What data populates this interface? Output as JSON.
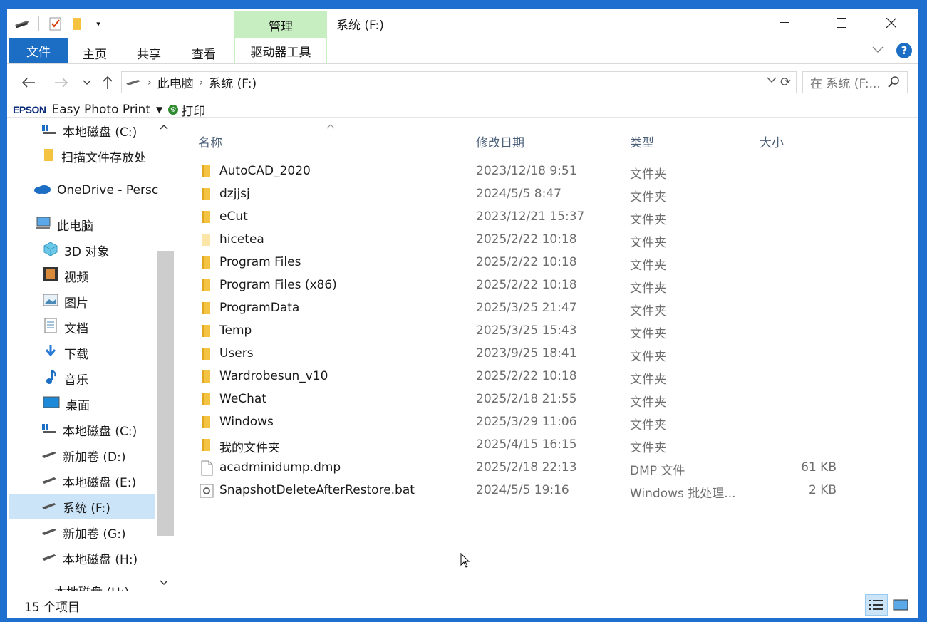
{
  "window": {
    "title": "系统 (F:)",
    "manage_tab": "管理",
    "minimize": "—",
    "maximize": "☐",
    "close": "✕"
  },
  "ribbon": {
    "file": "文件",
    "home": "主页",
    "share": "共享",
    "view": "查看",
    "drive_tools": "驱动器工具",
    "help": "?"
  },
  "address": {
    "breadcrumb": [
      "此电脑",
      "系统 (F:)"
    ],
    "search_placeholder": "在 系统 (F:..."
  },
  "epson": {
    "brand": "EPSON",
    "app": "Easy Photo Print",
    "print": "打印"
  },
  "sidebar": {
    "items": [
      {
        "label": "本地磁盘 (C:)",
        "icon": "windows-drive-icon"
      },
      {
        "label": "扫描文件存放处",
        "icon": "folder-icon"
      },
      {
        "label": "OneDrive - Persc",
        "icon": "onedrive-icon"
      },
      {
        "label": "此电脑",
        "icon": "computer-icon"
      },
      {
        "label": "3D 对象",
        "icon": "3d-objects-icon"
      },
      {
        "label": "视频",
        "icon": "video-icon"
      },
      {
        "label": "图片",
        "icon": "pictures-icon"
      },
      {
        "label": "文档",
        "icon": "documents-icon"
      },
      {
        "label": "下载",
        "icon": "download-icon"
      },
      {
        "label": "音乐",
        "icon": "music-icon"
      },
      {
        "label": "桌面",
        "icon": "desktop-icon"
      },
      {
        "label": "本地磁盘 (C:)",
        "icon": "windows-drive-icon"
      },
      {
        "label": "新加卷 (D:)",
        "icon": "drive-icon"
      },
      {
        "label": "本地磁盘 (E:)",
        "icon": "drive-icon"
      },
      {
        "label": "系统 (F:)",
        "icon": "drive-icon"
      },
      {
        "label": "新加卷 (G:)",
        "icon": "drive-icon"
      },
      {
        "label": "本地磁盘 (H:)",
        "icon": "drive-icon"
      },
      {
        "label": "本地磁盘 (H:)",
        "icon": "drive-icon"
      }
    ],
    "selected": "系统 (F:)"
  },
  "columns": {
    "name": "名称",
    "date": "修改日期",
    "type": "类型",
    "size": "大小"
  },
  "files": [
    {
      "name": "AutoCAD_2020",
      "date": "2023/12/18 9:51",
      "type": "文件夹",
      "size": "",
      "icon": "folder-icon"
    },
    {
      "name": "dzjjsj",
      "date": "2024/5/5 8:47",
      "type": "文件夹",
      "size": "",
      "icon": "folder-icon"
    },
    {
      "name": "eCut",
      "date": "2023/12/21 15:37",
      "type": "文件夹",
      "size": "",
      "icon": "folder-icon"
    },
    {
      "name": "hicetea",
      "date": "2025/2/22 10:18",
      "type": "文件夹",
      "size": "",
      "icon": "folder-hidden-icon"
    },
    {
      "name": "Program Files",
      "date": "2025/2/22 10:18",
      "type": "文件夹",
      "size": "",
      "icon": "folder-icon"
    },
    {
      "name": "Program Files (x86)",
      "date": "2025/2/22 10:18",
      "type": "文件夹",
      "size": "",
      "icon": "folder-icon"
    },
    {
      "name": "ProgramData",
      "date": "2025/3/25 21:47",
      "type": "文件夹",
      "size": "",
      "icon": "folder-icon"
    },
    {
      "name": "Temp",
      "date": "2025/3/25 15:43",
      "type": "文件夹",
      "size": "",
      "icon": "folder-icon"
    },
    {
      "name": "Users",
      "date": "2023/9/25 18:41",
      "type": "文件夹",
      "size": "",
      "icon": "folder-icon"
    },
    {
      "name": "Wardrobesun_v10",
      "date": "2025/2/22 10:18",
      "type": "文件夹",
      "size": "",
      "icon": "folder-icon"
    },
    {
      "name": "WeChat",
      "date": "2025/2/18 21:55",
      "type": "文件夹",
      "size": "",
      "icon": "folder-icon"
    },
    {
      "name": "Windows",
      "date": "2025/3/29 11:06",
      "type": "文件夹",
      "size": "",
      "icon": "folder-icon"
    },
    {
      "name": "我的文件夹",
      "date": "2025/4/15 16:15",
      "type": "文件夹",
      "size": "",
      "icon": "folder-icon"
    },
    {
      "name": "acadminidump.dmp",
      "date": "2025/2/18 22:13",
      "type": "DMP 文件",
      "size": "61 KB",
      "icon": "file-icon"
    },
    {
      "name": "SnapshotDeleteAfterRestore.bat",
      "date": "2024/5/5 19:16",
      "type": "Windows 批处理...",
      "size": "2 KB",
      "icon": "batch-file-icon"
    }
  ],
  "status": {
    "count": "15 个项目"
  },
  "colors": {
    "accent": "#1c6ec4",
    "manage": "#c7eec0",
    "selected": "#cce4f7",
    "folder": "#f5c342"
  }
}
